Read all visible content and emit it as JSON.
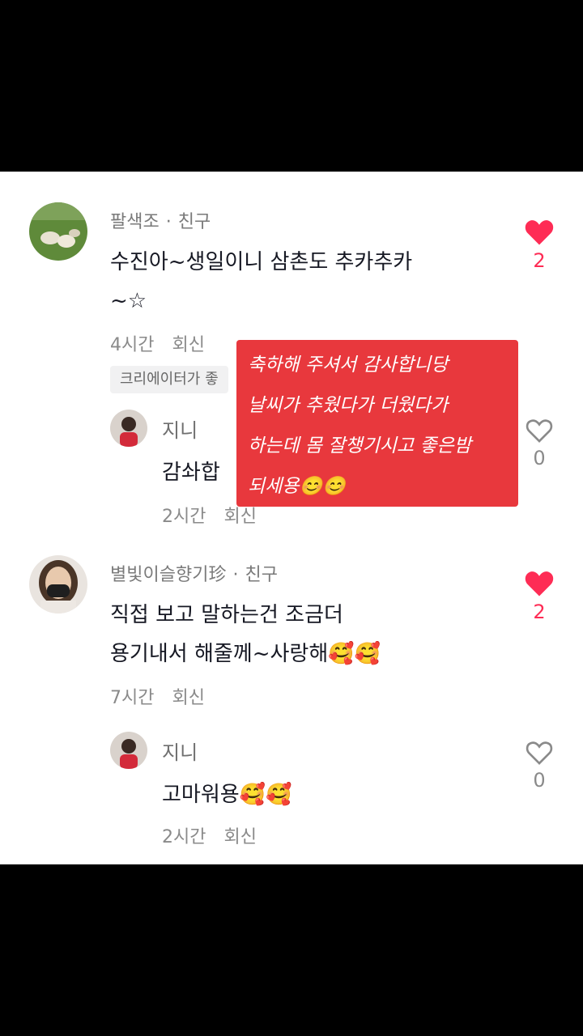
{
  "comments": [
    {
      "username": "팔색조",
      "relation": "친구",
      "text": "수진아~생일이니 삼촌도 추카추카\n~☆",
      "time": "4시간",
      "reply_label": "회신",
      "like_count": "2",
      "creator_tag": "크리에이터가 좋",
      "reply": {
        "username": "지니",
        "text": "감솨합",
        "time": "2시간",
        "reply_label": "회신",
        "like_count": "0"
      }
    },
    {
      "username": "별빛이슬향기珍",
      "relation": "친구",
      "text": "직접 보고 말하는건 조금더\n용기내서 해줄께~사랑해🥰🥰",
      "time": "7시간",
      "reply_label": "회신",
      "like_count": "2",
      "reply": {
        "username": "지니",
        "text": "고마워용🥰🥰",
        "time": "2시간",
        "reply_label": "회신",
        "like_count": "0"
      }
    }
  ],
  "overlay_text": "축하해 주셔서 감사합니당\n날씨가 추웠다가 더웠다가\n하는데 몸 잘챙기시고 좋은밤\n되세용😊😊",
  "colors": {
    "accent": "#fe2c55",
    "overlay": "#e8383d"
  }
}
